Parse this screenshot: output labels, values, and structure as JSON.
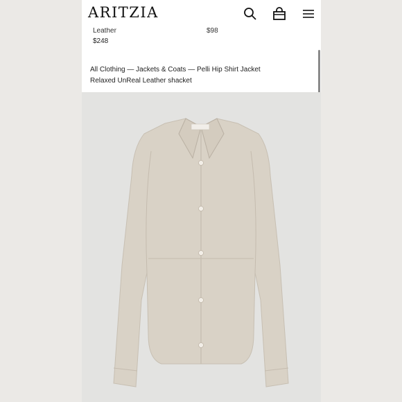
{
  "header": {
    "logo": "ARITZIA",
    "icons": [
      "search-icon",
      "bag-icon",
      "menu-icon"
    ]
  },
  "previous_products": {
    "item1_name": "Leather",
    "item1_price": "$248",
    "item2_price": "$98"
  },
  "breadcrumb": {
    "items": [
      "All Clothing",
      "Jackets & Coats",
      "Pelli Hip Shirt Jacket"
    ],
    "separator": " — "
  },
  "product": {
    "title": "Relaxed UnReal Leather shacket",
    "image_alt": "product-image-jacket"
  },
  "colors": {
    "jacket": "#d9d2c6",
    "background": "#e3e3e1",
    "text": "#222222"
  }
}
